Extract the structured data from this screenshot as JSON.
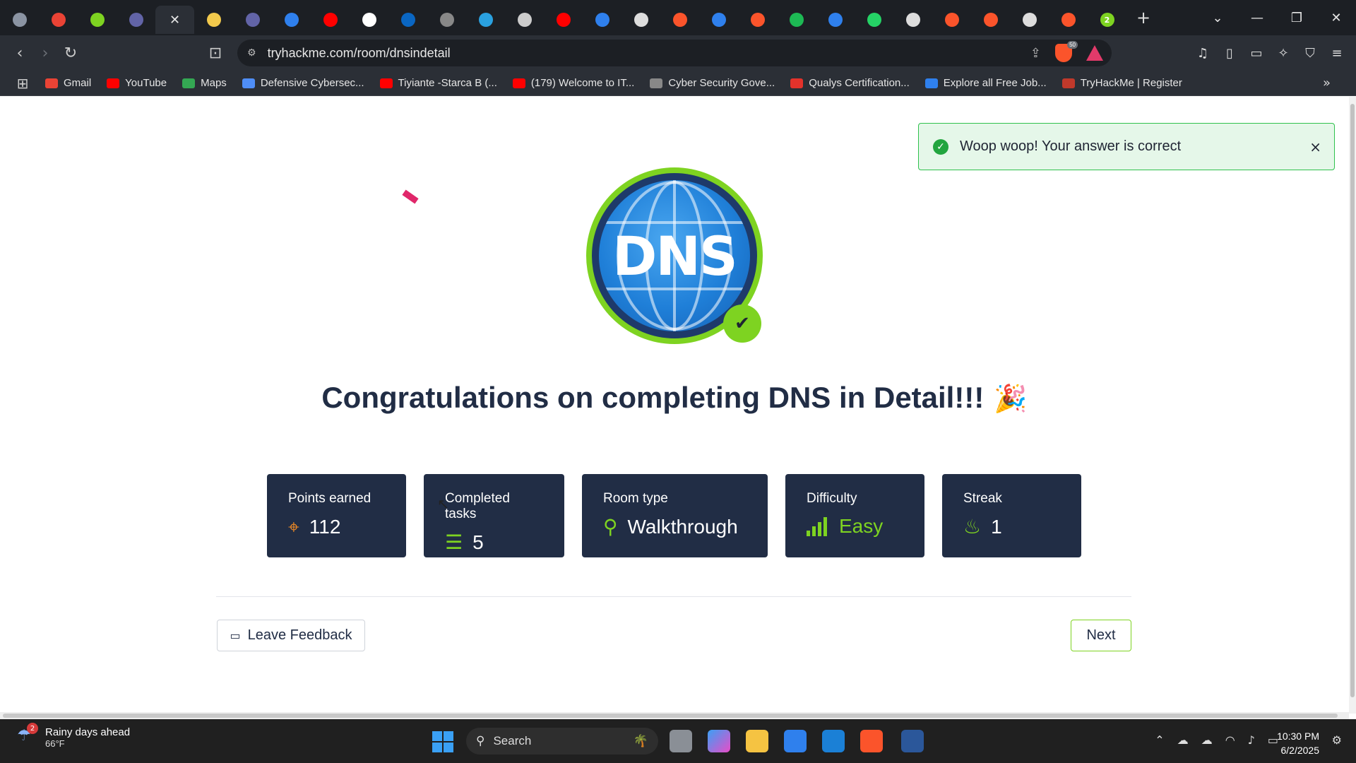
{
  "browser": {
    "tabs": [
      {
        "icon": "globe-icon",
        "color": "#8b94a3"
      },
      {
        "icon": "gmail-icon",
        "color": "#ea4335"
      },
      {
        "icon": "hexagon-icon",
        "color": "#7ed321"
      },
      {
        "icon": "teams-icon",
        "color": "#6264a7"
      },
      {
        "icon": "close-icon",
        "active": true
      },
      {
        "icon": "image-icon",
        "color": "#f2c94c"
      },
      {
        "icon": "teams-icon",
        "color": "#6264a7"
      },
      {
        "icon": "list-icon",
        "color": "#2f80ed"
      },
      {
        "icon": "youtube-icon",
        "color": "#ff0000"
      },
      {
        "icon": "github-icon",
        "color": "#ffffff"
      },
      {
        "icon": "linkedin-icon",
        "color": "#0a66c2"
      },
      {
        "icon": "loading-icon",
        "color": "#888888"
      },
      {
        "icon": "telegram-icon",
        "color": "#2aa1e0"
      },
      {
        "icon": "news-icon",
        "color": "#cccccc"
      },
      {
        "icon": "youtube-icon",
        "color": "#ff0000"
      },
      {
        "icon": "globe-icon",
        "color": "#2f80ed"
      },
      {
        "icon": "tool-icon",
        "color": "#dddddd"
      },
      {
        "icon": "brave-icon",
        "color": "#fb542b"
      },
      {
        "icon": "chat-icon",
        "color": "#2f80ed"
      },
      {
        "icon": "brave-icon",
        "color": "#fb542b"
      },
      {
        "icon": "c-icon",
        "color": "#1db954"
      },
      {
        "icon": "info-icon",
        "color": "#2f80ed"
      },
      {
        "icon": "whatsapp-icon",
        "color": "#25d366"
      },
      {
        "icon": "medium-icon",
        "color": "#dddddd"
      },
      {
        "icon": "brave-icon",
        "color": "#fb542b"
      },
      {
        "icon": "brave-icon",
        "color": "#fb542b"
      },
      {
        "icon": "medium-icon",
        "color": "#dddddd"
      },
      {
        "icon": "brave-icon",
        "color": "#fb542b"
      },
      {
        "icon": "two-icon",
        "color": "#7ed321",
        "text": "2"
      }
    ],
    "new_tab": "+",
    "url": "tryhackme.com/room/dnsindetail",
    "shield_count": "50",
    "bookmarks": [
      {
        "label": "Gmail",
        "color": "#ea4335"
      },
      {
        "label": "YouTube",
        "color": "#ff0000"
      },
      {
        "label": "Maps",
        "color": "#34a853"
      },
      {
        "label": "Defensive Cybersec...",
        "color": "#4f8ef7"
      },
      {
        "label": "Tiyiante -Starca B (...",
        "color": "#ff0000"
      },
      {
        "label": "(179) Welcome to IT...",
        "color": "#ff0000"
      },
      {
        "label": "Cyber Security Gove...",
        "color": "#888888"
      },
      {
        "label": "Qualys Certification...",
        "color": "#e4322b"
      },
      {
        "label": "Explore all Free Job...",
        "color": "#2f80ed"
      },
      {
        "label": "TryHackMe | Register",
        "color": "#c0392b"
      }
    ]
  },
  "toast": {
    "message": "Woop woop! Your answer is correct",
    "close": "×"
  },
  "badge": {
    "text": "DNS",
    "check": "✔"
  },
  "title": "Congratulations on completing DNS in Detail!!!",
  "title_emoji": "🎉",
  "stats": [
    {
      "label": "Points earned",
      "value": "112",
      "icon": "target-icon"
    },
    {
      "label": "Completed tasks",
      "value": "5",
      "icon": "checklist-icon"
    },
    {
      "label": "Room type",
      "value": "Walkthrough",
      "icon": "route-icon"
    },
    {
      "label": "Difficulty",
      "value": "Easy",
      "icon": "signal-bars-icon"
    },
    {
      "label": "Streak",
      "value": "1",
      "icon": "flame-icon"
    }
  ],
  "buttons": {
    "feedback": "Leave Feedback",
    "next": "Next"
  },
  "taskbar": {
    "weather_title": "Rainy days ahead",
    "weather_temp": "66°F",
    "weather_badge": "2",
    "search_placeholder": "Search",
    "time": "10:30 PM",
    "date": "6/2/2025"
  },
  "colors": {
    "accent_green": "#7ed321",
    "card_bg": "#212d45",
    "points_orange": "#f08a24",
    "toast_bg": "#e5f7e9"
  }
}
